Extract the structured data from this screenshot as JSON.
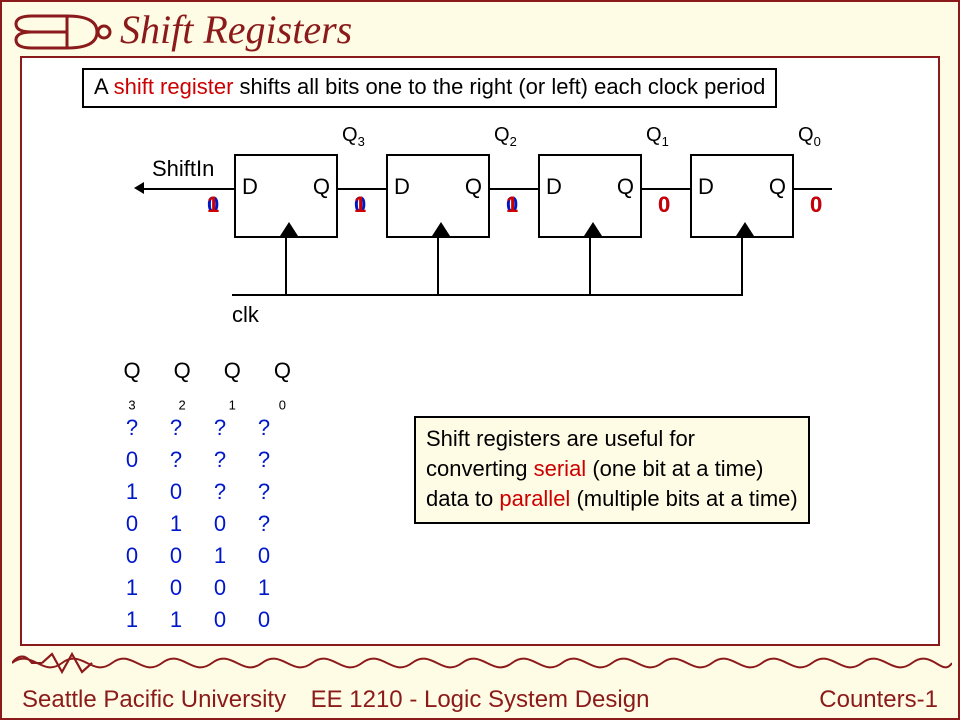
{
  "title": "Shift Registers",
  "definition": {
    "pre": "A ",
    "term": "shift register",
    "post": " shifts all bits one to the right (or left) each clock period"
  },
  "circuit": {
    "shiftIn": "ShiftIn",
    "clk": "clk",
    "ff": {
      "d": "D",
      "q": "Q"
    },
    "outputs": [
      "Q",
      "Q",
      "Q",
      "Q"
    ],
    "outputSubs": [
      "3",
      "2",
      "1",
      "0"
    ],
    "nodeVals": {
      "shiftIn": {
        "blue": "0",
        "red": "1"
      },
      "q3": {
        "blue": "0",
        "red": "1"
      },
      "q2": {
        "blue": "0",
        "red": "1"
      },
      "q1": {
        "blue": "0",
        "red": "0"
      },
      "q0": {
        "blue": "0",
        "red": "0"
      }
    }
  },
  "table": {
    "headers": [
      "Q",
      "Q",
      "Q",
      "Q"
    ],
    "headerSubs": [
      "3",
      "2",
      "1",
      "0"
    ],
    "rows": [
      [
        "?",
        "?",
        "?",
        "?"
      ],
      [
        "0",
        "?",
        "?",
        "?"
      ],
      [
        "1",
        "0",
        "?",
        "?"
      ],
      [
        "0",
        "1",
        "0",
        "?"
      ],
      [
        "0",
        "0",
        "1",
        "0"
      ],
      [
        "1",
        "0",
        "0",
        "1"
      ],
      [
        "1",
        "1",
        "0",
        "0"
      ]
    ]
  },
  "note": {
    "line1a": "Shift registers are useful for",
    "line2a": "converting ",
    "serial": "serial",
    "line2b": " (one bit at a time)",
    "line3a": "data to ",
    "parallel": "parallel",
    "line3b": " (multiple bits at a time)"
  },
  "footer": {
    "left": "Seattle Pacific University",
    "mid": "EE 1210 - Logic System Design",
    "right": "Counters-1"
  }
}
